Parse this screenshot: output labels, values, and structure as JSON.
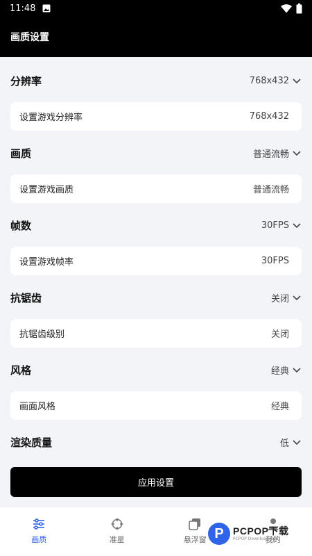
{
  "status_bar": {
    "time": "11:48"
  },
  "app_bar": {
    "title": "画质设置"
  },
  "sections": [
    {
      "title": "分辨率",
      "value": "768x432",
      "card_label": "设置游戏分辨率",
      "card_value": "768x432"
    },
    {
      "title": "画质",
      "value": "普通流畅",
      "card_label": "设置游戏画质",
      "card_value": "普通流畅"
    },
    {
      "title": "帧数",
      "value": "30FPS",
      "card_label": "设置游戏帧率",
      "card_value": "30FPS"
    },
    {
      "title": "抗锯齿",
      "value": "关闭",
      "card_label": "抗锯齿级别",
      "card_value": "关闭"
    },
    {
      "title": "风格",
      "value": "经典",
      "card_label": "画面风格",
      "card_value": "经典"
    },
    {
      "title": "渲染质量",
      "value": "低"
    }
  ],
  "apply_button": {
    "label": "应用设置"
  },
  "tabs": [
    {
      "label": "画质",
      "icon": "sliders-icon",
      "active": true
    },
    {
      "label": "准星",
      "icon": "crosshair-icon",
      "active": false
    },
    {
      "label": "悬浮窗",
      "icon": "window-stack-icon",
      "active": false
    },
    {
      "label": "我的",
      "icon": "user-icon",
      "active": false
    }
  ],
  "watermark": {
    "brand": "PCPOP下载",
    "sub": "PCPOP Download App"
  },
  "colors": {
    "accent": "#2f63e8",
    "header_bg": "#000000",
    "page_bg": "#f3f4f8"
  }
}
